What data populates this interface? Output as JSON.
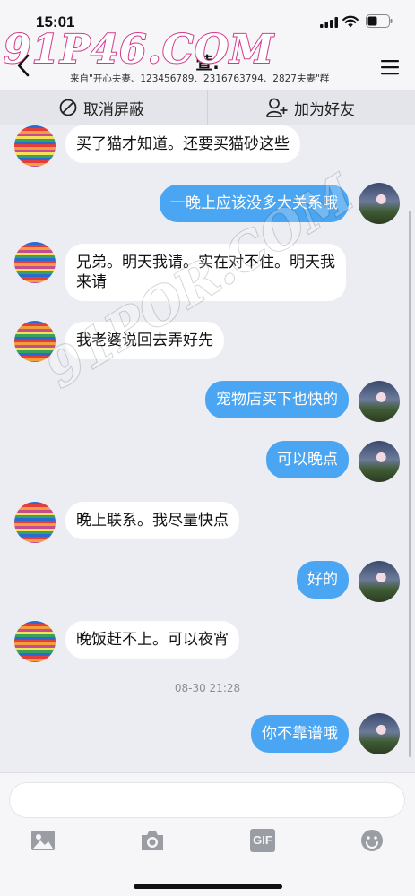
{
  "status_bar": {
    "time": "15:01"
  },
  "nav": {
    "title": "萱.",
    "subtitle": "来自\"开心夫妻、123456789、2316763794、2827夫妻\"群"
  },
  "actions": {
    "unblock_label": "取消屏蔽",
    "add_friend_label": "加为好友"
  },
  "watermarks": {
    "top": "91P46.COM",
    "diagonal": "91POR.COM"
  },
  "messages": [
    {
      "side": "left",
      "text": "买了猫才知道。还要买猫砂这些"
    },
    {
      "side": "right",
      "text": "一晚上应该没多大关系哦"
    },
    {
      "side": "left",
      "text": "兄弟。明天我请。实在对不住。明天我来请"
    },
    {
      "side": "left",
      "text": "我老婆说回去弄好先"
    },
    {
      "side": "right",
      "text": "宠物店买下也快的"
    },
    {
      "side": "right",
      "text": "可以晚点"
    },
    {
      "side": "left",
      "text": "晚上联系。我尽量快点"
    },
    {
      "side": "right",
      "text": "好的"
    },
    {
      "side": "left",
      "text": "晚饭赶不上。可以夜宵"
    },
    {
      "side": "right",
      "text": "你不靠谱哦"
    }
  ],
  "timestamp": "08-30 21:28",
  "input": {
    "value": "",
    "placeholder": ""
  },
  "toolbar": {
    "gif_label": "GIF"
  },
  "colors": {
    "bubble_self": "#4aa6f2",
    "bubble_other": "#ffffff",
    "background": "#ebedf3",
    "watermark": "#d2398a"
  }
}
